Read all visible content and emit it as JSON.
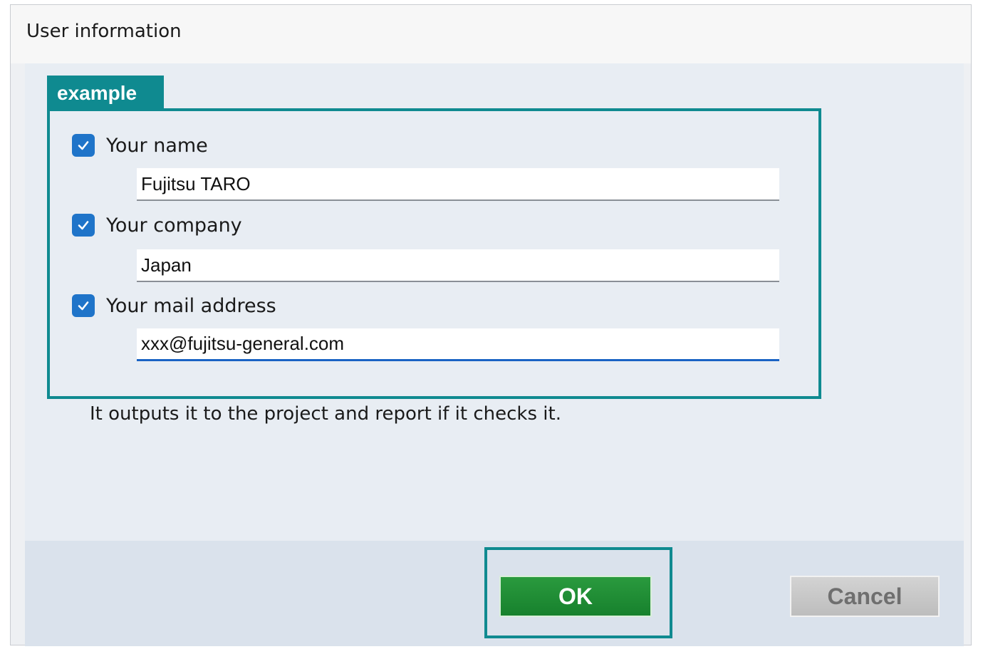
{
  "window": {
    "title": "User information"
  },
  "annotation": {
    "example_label": "example"
  },
  "form": {
    "name": {
      "label": "Your name",
      "checked": true,
      "value": "Fujitsu TARO"
    },
    "company": {
      "label": "Your company",
      "checked": true,
      "value": "Japan"
    },
    "mail": {
      "label": "Your mail address",
      "checked": true,
      "value": "xxx@fujitsu-general.com"
    },
    "hint": "It outputs it to the project and report if it checks it."
  },
  "buttons": {
    "ok_label": "OK",
    "cancel_label": "Cancel"
  },
  "colors": {
    "accent_teal": "#0f8a90",
    "checkbox_blue": "#1f74c9",
    "ok_green": "#17812d",
    "cancel_gray": "#bdbdbd"
  },
  "icons": {
    "checkbox": "checkmark-icon"
  }
}
